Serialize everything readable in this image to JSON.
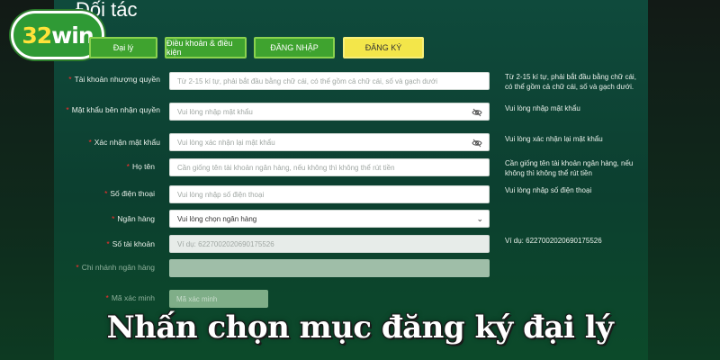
{
  "page_title": "Đối tác",
  "logo": {
    "num": "32",
    "word": "win"
  },
  "tabs": [
    {
      "label": "Đại lý",
      "active": false
    },
    {
      "label": "Điều khoản & điều kiện",
      "active": false
    },
    {
      "label": "ĐĂNG NHẬP",
      "active": false
    },
    {
      "label": "ĐĂNG KÝ",
      "active": true
    }
  ],
  "form": {
    "username": {
      "label": "Tài khoản nhượng quyền",
      "placeholder": "Từ 2-15 kí tự, phải bắt đầu bằng chữ cái, có thể  gồm cả chữ cái, số và gạch dưới",
      "hint": "Từ 2-15 kí tự, phải bắt đầu bằng chữ cái, có thể gồm cả chữ cái, số và gạch dưới."
    },
    "password": {
      "label": "Mật khẩu bên nhận quyền",
      "placeholder": "Vui lòng nhập mật khẩu",
      "hint": "Vui lòng nhập mật khẩu"
    },
    "confirm_password": {
      "label": "Xác nhận mật khẩu",
      "placeholder": "Vui lòng xác nhận lại mật khẩu",
      "hint": "Vui lòng xác nhận lại mật khẩu"
    },
    "full_name": {
      "label": "Họ tên",
      "placeholder": "Cần giống tên tài khoản ngân hàng, nếu không thì không thể rút tiền",
      "hint": "Cần giống tên tài khoản ngân hàng, nếu không thì không thể rút tiền"
    },
    "phone": {
      "label": "Số điện thoại",
      "placeholder": "Vui lòng nhập số điện thoại",
      "hint": "Vui lòng nhập số điện thoại"
    },
    "bank": {
      "label": "Ngân hàng",
      "value": "Vui lòng chọn ngân hàng"
    },
    "account_number": {
      "label": "Số tài khoản",
      "placeholder": "Ví dụ:  6227002020690175526",
      "hint": "Ví dụ:  6227002020690175526"
    },
    "branch": {
      "label": "Chi nhánh ngân hàng",
      "placeholder": ""
    },
    "captcha": {
      "label": "Mã xác minh",
      "placeholder": "Mã xác minh"
    }
  },
  "caption": "Nhấn chọn mục đăng ký đại lý"
}
